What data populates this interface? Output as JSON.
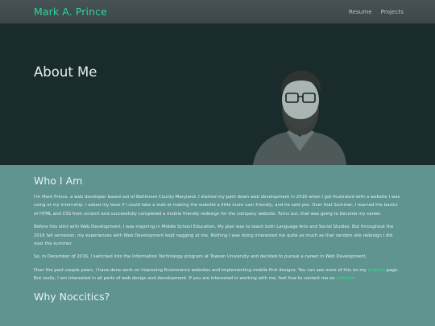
{
  "nav": {
    "brand": "Mark A. Prince",
    "links": [
      {
        "label": "Resume"
      },
      {
        "label": "Projects"
      }
    ]
  },
  "hero": {
    "title": "About Me"
  },
  "who": {
    "title": "Who I Am",
    "p1": "I'm Mark Prince, a web developer based out of Baltimore County Maryland. I started my path down web development in 2016 when I got frustrated with a website I was using at my internship. I asked my boss if I could take a stab at making the website a little more user friendly, and he said yes. Over that Summer, I learned the basics of HTML and CSS from scratch and successfully completed a mobile friendly redesign for the company website. Turns out, that was going to become my career.",
    "p2": "Before this stint with Web Development, I was majoring in Middle School Education. My plan was to teach both Language Arts and Social Studies. But throughout the 2016 fall semester, my experiences with Web Development kept nagging at me. Nothing I was doing interested me quite as much as that random site redesign I did over the summer.",
    "p3": "So, in December of 2016, I switched into the Information Technology program at Towson University and decided to pursue a career in Web Development.",
    "p4_a": "Over the past couple years, I have done work on improving Ecommerce websites and implementing mobile first designs. You can see more of this on my ",
    "p4_link1": "projects",
    "p4_b": " page. But really, I am interested in all parts of web design and development. If you are interested in working with me, feel free to contact me on ",
    "p4_link2": "Linkedin",
    "p4_c": "."
  },
  "why": {
    "title": "Why Noccitics?"
  },
  "colors": {
    "accent": "#2fd59b",
    "hero_bg": "#1a2b2b",
    "content_bg": "#5f9490"
  }
}
